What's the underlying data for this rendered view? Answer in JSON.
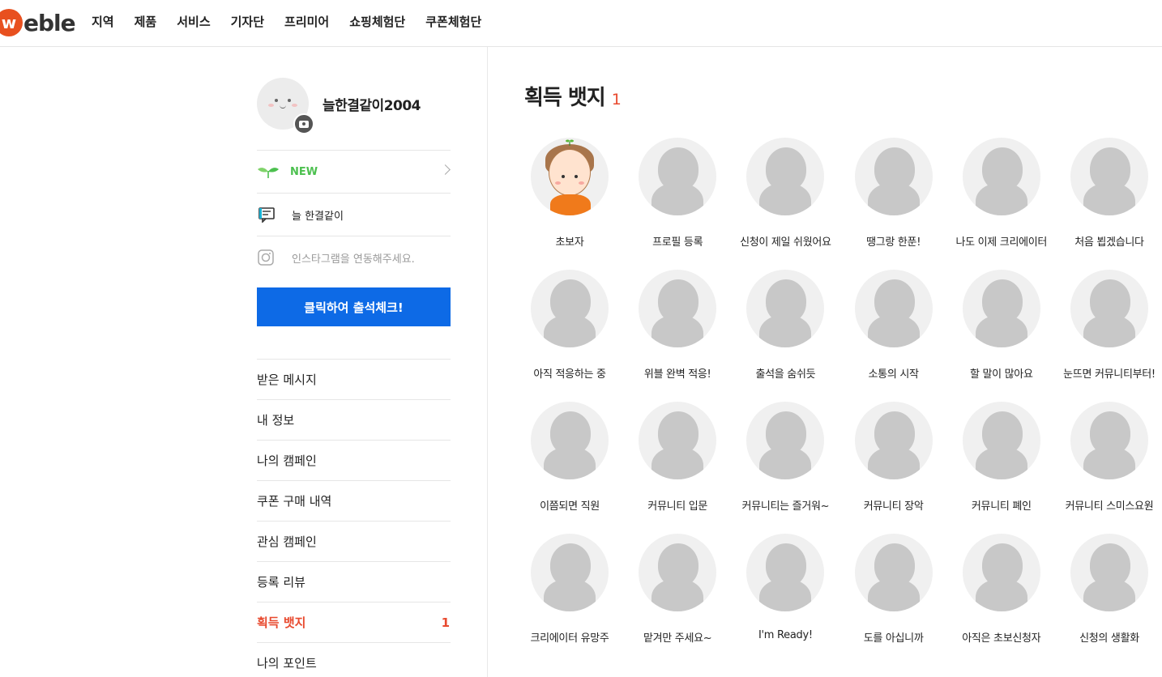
{
  "logo": {
    "mark": "w",
    "text": "eble"
  },
  "nav": [
    "지역",
    "제품",
    "서비스",
    "기자단",
    "프리미어",
    "쇼핑체험단",
    "쿠폰체험단"
  ],
  "profile": {
    "nickname": "늘한결같이2004"
  },
  "sidebar": {
    "new_label": "NEW",
    "status_text": "늘 한결같이",
    "instagram_text": "인스타그램을 연동해주세요.",
    "attendance_button": "클릭하여 출석체크!",
    "menu": [
      {
        "label": "받은 메시지",
        "count": ""
      },
      {
        "label": "내 정보",
        "count": ""
      },
      {
        "label": "나의 캠페인",
        "count": ""
      },
      {
        "label": "쿠폰 구매 내역",
        "count": ""
      },
      {
        "label": "관심 캠페인",
        "count": ""
      },
      {
        "label": "등록 리뷰",
        "count": ""
      },
      {
        "label": "획득 뱃지",
        "count": "1"
      },
      {
        "label": "나의 포인트",
        "count": ""
      }
    ]
  },
  "main": {
    "title": "획득 뱃지",
    "count": "1",
    "badges": [
      "초보자",
      "프로필 등록",
      "신청이 제일 쉬웠어요",
      "땡그랑 한푼!",
      "나도 이제 크리에이터",
      "처음 뵙겠습니다",
      "아직 적응하는 중",
      "위블 완벽 적응!",
      "출석을 숨쉬듯",
      "소통의 시작",
      "할 말이 많아요",
      "눈뜨면 커뮤니티부터!",
      "이쯤되면 직원",
      "커뮤니티 입문",
      "커뮤니티는 즐거워~",
      "커뮤니티 장악",
      "커뮤니티 폐인",
      "커뮤니티 스미스요원",
      "크리에이터 유망주",
      "맡겨만 주세요~",
      "I'm Ready!",
      "도를 아십니까",
      "아직은 초보신청자",
      "신청의 생활화"
    ]
  },
  "colors": {
    "accent_red": "#e84a2f",
    "button_blue": "#0d6ae6",
    "new_green": "#4cc04f",
    "logo_orange": "#e8501f"
  }
}
